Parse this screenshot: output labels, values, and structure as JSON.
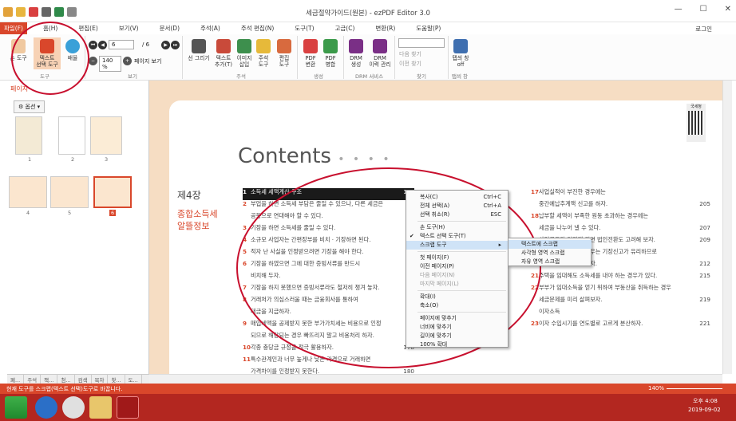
{
  "window": {
    "title": "세금절약가이드(원본) - ezPDF Editor 3.0"
  },
  "menu": {
    "items": [
      "파일(F)",
      "홈(H)",
      "편집(E)",
      "보기(V)",
      "문서(D)",
      "주석(A)",
      "주석 편집(N)",
      "도구(T)",
      "고급(C)",
      "변환(R)",
      "도움말(P)"
    ],
    "login": "로그인"
  },
  "ribbon": {
    "hand_tool": "손 도구",
    "select_tool": "텍스트\n선택 도구",
    "zoom": "배율",
    "group_tools": "도구",
    "page_value": "6",
    "page_total": "/ 6",
    "zoom_value": "140 %",
    "page_view": "페이지 보기",
    "group_view": "보기",
    "draw_line": "선 그리기",
    "add_text": "텍스트\n추가(T)",
    "insert_image": "이미지\n삽입",
    "annot": "주석\n도구",
    "edit_tool": "편집\n도구",
    "group_annot": "주석",
    "pdf_convert": "PDF\n변환",
    "pdf_merge": "PDF\n병합",
    "group_create": "생성",
    "drm_create": "DRM\n생성",
    "drm_history": "DRM\n이력 관리",
    "group_drm": "DRM 서비스",
    "find_next": "다음 찾기",
    "find_prev": "이전 찾기",
    "group_find": "찾기",
    "tab_off": "탭씌 창\noff",
    "group_tab": "탭씌 창"
  },
  "panel": {
    "title": "페이지",
    "options": "옵션",
    "thumb_labels": [
      "1",
      "2",
      "3",
      "4",
      "5",
      "6"
    ],
    "tabs": [
      "페...",
      "주석",
      "책...",
      "첨...",
      "검색",
      "목차",
      "찾...",
      "도..."
    ]
  },
  "document": {
    "contents_title": "Contents",
    "chapter": "제4장",
    "chapter_title": "종합소득세\n알뜰정보",
    "left_items": [
      {
        "n": "1",
        "t": "소득세 세액계산 구조",
        "p": "154"
      },
      {
        "n": "2",
        "t": "부업을 하면 소득세 부담은 줄일 수 있으나, 다른 세금은",
        "p": ""
      },
      {
        "n": "",
        "t": "공동으로 연대해야 할 수 있다.",
        "p": "15"
      },
      {
        "n": "3",
        "t": "기장을 하면 소득세를 줄일 수 있다.",
        "p": "15"
      },
      {
        "n": "4",
        "t": "소규모 사업자는 간편장부를 비치 · 기장하면 된다.",
        "p": "15"
      },
      {
        "n": "5",
        "t": "적자 난 사실을 인정받으려면 기장을 해야 한다.",
        "p": "16"
      },
      {
        "n": "6",
        "t": "기장을 하였으면 그에 대한 증빙서류를 반드시",
        "p": ""
      },
      {
        "n": "",
        "t": "비치해 두자.",
        "p": "16"
      },
      {
        "n": "7",
        "t": "기장을 하지 못했으면 증빙서류라도 철저히 챙겨 놓자.",
        "p": "17"
      },
      {
        "n": "8",
        "t": "거래처가 의심스러울 때는 금융회사를 통하여",
        "p": ""
      },
      {
        "n": "",
        "t": "대금을 지급하자.",
        "p": "17"
      },
      {
        "n": "9",
        "t": "매입세액을 공제받지 못한 부가가치세는 비용으로 인정",
        "p": ""
      },
      {
        "n": "",
        "t": "되므로 해당되는 경우 빠뜨리지 말고 비용처리 하자.",
        "p": "17"
      },
      {
        "n": "10",
        "t": "각종 충당금 규정을 적극 활용하자.",
        "p": "178"
      },
      {
        "n": "11",
        "t": "특수관계인과 너무 높게나 낮은 가격으로 거래하면",
        "p": ""
      },
      {
        "n": "",
        "t": "가격차이를 인정받지 못한다.",
        "p": "180"
      }
    ],
    "right_items": [
      {
        "n": "17",
        "t": "사업실적이 부진한 경우에는",
        "p": ""
      },
      {
        "n": "",
        "t": "중간예납추계액 신고를 하자.",
        "p": "205"
      },
      {
        "n": "18",
        "t": "납부할 세액이 부족한 원동 초과하는 경우에는",
        "p": ""
      },
      {
        "n": "",
        "t": "세금을 나누어 낼 수 있다.",
        "p": "207"
      },
      {
        "n": "19",
        "t": "사업규모가 커지게 되면 법인전환도 고려해 보자.",
        "p": "209"
      },
      {
        "n": "",
        "t": "부동산을 임대하는 경우는 기장신고가 유리하므로",
        "p": ""
      },
      {
        "n": "",
        "t": "장부를 기장하도록 하자.",
        "p": "212"
      },
      {
        "n": "21",
        "t": "주택을 임대해도 소득세를 내야 하는 경우가 있다.",
        "p": "215"
      },
      {
        "n": "22",
        "t": "부부가 임대소득을 얻기 위하여 부동산을 취득하는 경우",
        "p": ""
      },
      {
        "n": "",
        "t": "세금문제를 미리 살펴보자.",
        "p": "219"
      },
      {
        "n": "",
        "t": "이자소득",
        "p": ""
      },
      {
        "n": "23",
        "t": "이자 수입시기를 연도별로 고르게 분산하자.",
        "p": "221"
      }
    ],
    "stamp": "국세청"
  },
  "context_menu": {
    "items": [
      {
        "label": "복사(C)",
        "shortcut": "Ctrl+C"
      },
      {
        "label": "전체 선택(A)",
        "shortcut": "Ctrl+A"
      },
      {
        "label": "선택 취소(R)",
        "shortcut": "ESC"
      },
      {
        "label": "손 도구(H)",
        "shortcut": ""
      },
      {
        "label": "텍스트 선택 도구(T)",
        "shortcut": ""
      },
      {
        "label": "스크랩 도구",
        "shortcut": "▸"
      },
      {
        "label": "첫 페이지(F)",
        "shortcut": ""
      },
      {
        "label": "이전 페이지(P)",
        "shortcut": ""
      },
      {
        "label": "다음 페이지(N)",
        "shortcut": ""
      },
      {
        "label": "마지막 페이지(L)",
        "shortcut": ""
      },
      {
        "label": "확대(I)",
        "shortcut": ""
      },
      {
        "label": "축소(O)",
        "shortcut": ""
      },
      {
        "label": "페이지에 맞추기",
        "shortcut": ""
      },
      {
        "label": "너비에 맞추기",
        "shortcut": ""
      },
      {
        "label": "길이에 맞추기",
        "shortcut": ""
      },
      {
        "label": "100% 확대",
        "shortcut": ""
      }
    ],
    "checkmark": "✔"
  },
  "submenu": {
    "items": [
      "텍스트에 스크랩",
      "사각형 영역 스크랩",
      "자유 영역 스크랩"
    ]
  },
  "status": {
    "text": "현재 도구를 스크랩(텍스트 선택)도구로 바꿉니다.",
    "zoom": "140%"
  },
  "taskbar": {
    "time": "오후 4:08",
    "date": "2019-09-02"
  },
  "colors": {
    "accent": "#d9472b",
    "taskbar": "#b32720",
    "page_bg": "#f6ddc3",
    "annotation": "#c8102e"
  }
}
